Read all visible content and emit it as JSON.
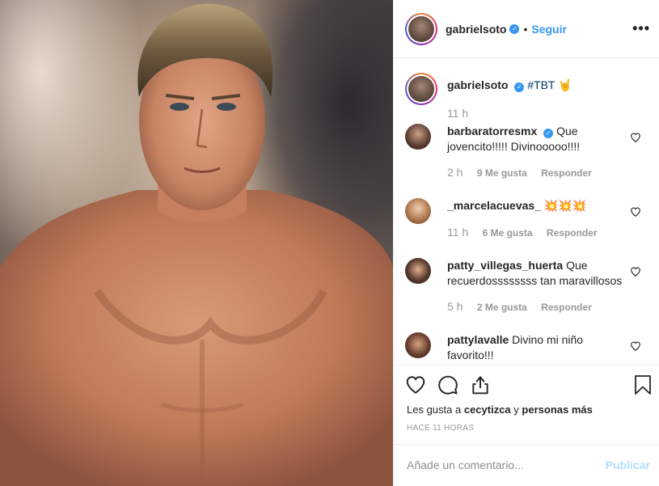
{
  "post": {
    "author": "gabrielsoto",
    "follow_label": "Seguir",
    "separator": "•",
    "more_label": "•••",
    "caption_hashtag": "#TBT",
    "caption_emoji": "🤘",
    "caption_time": "11 h"
  },
  "comments": [
    {
      "user": "barbaratorresmx",
      "verified": true,
      "text": "Que jovencito!!!!! Divinooooo!!!!",
      "time": "2 h",
      "likes": "9 Me gusta",
      "reply": "Responder"
    },
    {
      "user": "_marcelacuevas_",
      "verified": false,
      "text": "💥💥💥",
      "time": "11 h",
      "likes": "6 Me gusta",
      "reply": "Responder"
    },
    {
      "user": "patty_villegas_huerta",
      "verified": false,
      "text": "Que recuerdossssssss tan maravillosos",
      "time": "5 h",
      "likes": "2 Me gusta",
      "reply": "Responder"
    },
    {
      "user": "pattylavalle",
      "verified": false,
      "text": "Divino mi niño favorito!!!",
      "time": "",
      "likes": "",
      "reply": ""
    }
  ],
  "likes": {
    "prefix": "Les gusta a",
    "user": "cecytizca",
    "middle": "y",
    "others": "personas más"
  },
  "time_ago": "HACE 11 HORAS",
  "add_comment": {
    "placeholder": "Añade un comentario...",
    "post_label": "Publicar"
  },
  "icons": {
    "verified": "verified-badge-icon",
    "like": "heart-icon",
    "comment": "comment-bubble-icon",
    "share": "share-icon",
    "save": "bookmark-icon",
    "more": "more-options-icon"
  },
  "colors": {
    "link_blue": "#3897f0",
    "hashtag": "#003569",
    "muted": "#999999",
    "publish_disabled": "#b2dffc"
  }
}
